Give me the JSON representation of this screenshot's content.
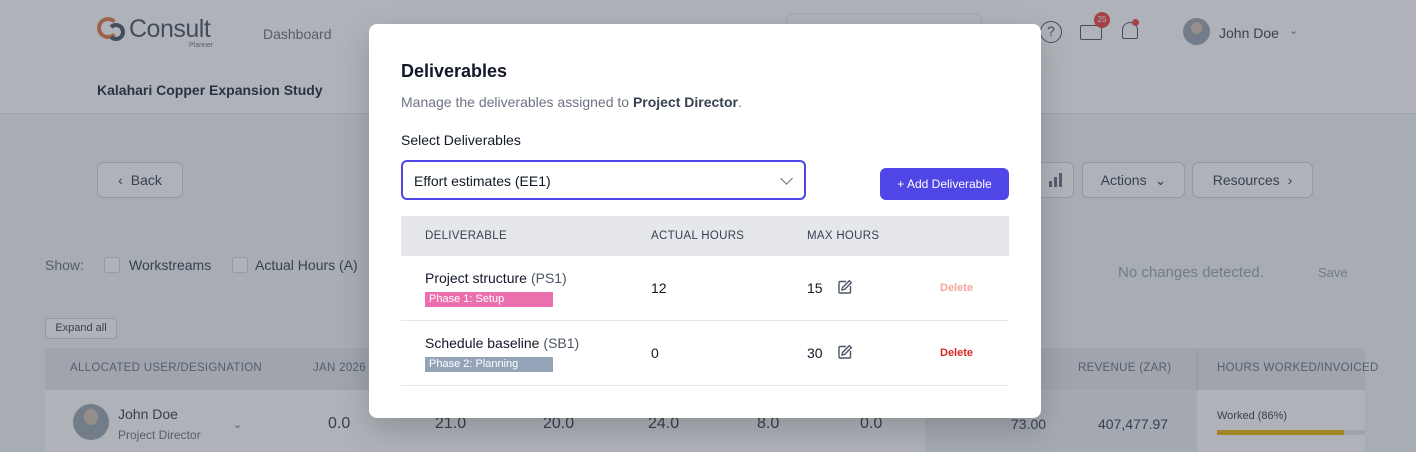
{
  "app": {
    "logo_text": "Consult",
    "logo_sub": "Planner",
    "nav": {
      "dashboard": "Dashboard"
    },
    "mail_count": "25",
    "user": {
      "name": "John Doe"
    },
    "project_title": "Kalahari Copper Expansion Study"
  },
  "toolbar": {
    "back": "Back",
    "actions": "Actions",
    "resources": "Resources"
  },
  "filters": {
    "show_label": "Show:",
    "workstreams": "Workstreams",
    "actual_hours": "Actual Hours (A)",
    "no_changes": "No changes detected.",
    "save": "Save",
    "expand_all": "Expand all"
  },
  "allocation_table": {
    "headers": {
      "user": "ALLOCATED USER/DESIGNATION",
      "jan": "JAN 2026",
      "revenue": "REVENUE (ZAR)",
      "hours": "HOURS WORKED/INVOICED"
    },
    "row": {
      "name": "John Doe",
      "role": "Project Director",
      "values": [
        "0.0",
        "21.0",
        "20.0",
        "24.0",
        "8.0",
        "0.0"
      ],
      "total": "73.00",
      "revenue": "407,477.97",
      "worked_label": "Worked (86%)",
      "worked_fraction": 0.86
    }
  },
  "modal": {
    "title": "Deliverables",
    "desc_prefix": "Manage the deliverables assigned to ",
    "desc_role": "Project Director",
    "desc_suffix": ".",
    "select_label": "Select Deliverables",
    "select_value": "Effort estimates (EE1)",
    "add_button": "+ Add Deliverable",
    "headers": {
      "deliverable": "DELIVERABLE",
      "actual": "ACTUAL HOURS",
      "max": "MAX HOURS"
    },
    "rows": [
      {
        "name": "Project structure",
        "code": "(PS1)",
        "phase": "Phase 1: Setup",
        "phase_color": "#ec6fae",
        "actual": "12",
        "max": "15",
        "delete": "Delete"
      },
      {
        "name": "Schedule baseline",
        "code": "(SB1)",
        "phase": "Phase 2: Planning",
        "phase_color": "#94a3b8",
        "actual": "0",
        "max": "30",
        "delete": "Delete"
      }
    ]
  },
  "colors": {
    "primary": "#4f46e5",
    "delete_active": "#dc2626",
    "delete_faded": "#f5a59b",
    "worked_bar": "#eab308"
  }
}
